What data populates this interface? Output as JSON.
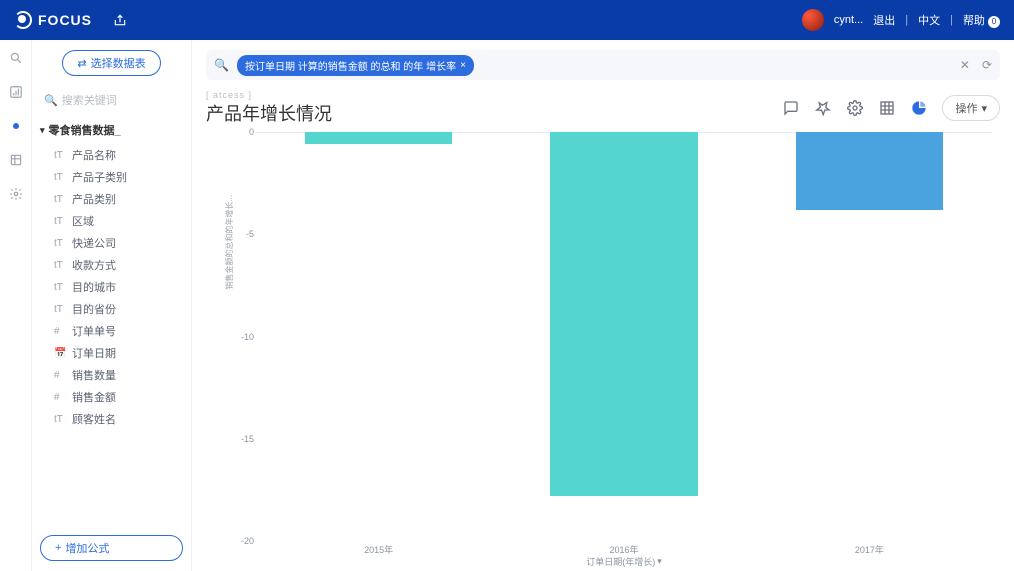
{
  "brand": "FOCUS",
  "header": {
    "user": "cynt...",
    "logout": "退出",
    "lang": "中文",
    "help": "帮助",
    "help_badge": "0"
  },
  "sidebar": {
    "select_btn": "选择数据表",
    "search_placeholder": "搜索关键词",
    "group": "零食销售数据_",
    "items": [
      {
        "icon": "tT",
        "label": "产品名称"
      },
      {
        "icon": "tT",
        "label": "产品子类别"
      },
      {
        "icon": "tT",
        "label": "产品类别"
      },
      {
        "icon": "tT",
        "label": "区域"
      },
      {
        "icon": "tT",
        "label": "快递公司"
      },
      {
        "icon": "tT",
        "label": "收款方式"
      },
      {
        "icon": "tT",
        "label": "目的城市"
      },
      {
        "icon": "tT",
        "label": "目的省份"
      },
      {
        "icon": "#",
        "label": "订单单号"
      },
      {
        "icon": "📅",
        "label": "订单日期"
      },
      {
        "icon": "#",
        "label": "销售数量"
      },
      {
        "icon": "#",
        "label": "销售金额"
      },
      {
        "icon": "tT",
        "label": "顾客姓名"
      }
    ],
    "add_formula": "增加公式"
  },
  "query": {
    "chip": "按订单日期 计算的销售金额 的总和 的年 增长率",
    "chip_close": "×"
  },
  "page": {
    "breadcrumb": "[ atcess ]",
    "title": "产品年增长情况",
    "op_btn": "操作"
  },
  "chart_data": {
    "type": "bar",
    "title": "产品年增长情况",
    "xlabel": "订单日期(年增长)",
    "ylabel": "销售金额的总和的年增长...",
    "categories": [
      "2015年",
      "2016年",
      "2017年"
    ],
    "values": [
      -0.6,
      -17.8,
      -3.8
    ],
    "ylim": [
      -20,
      0
    ],
    "y_ticks": [
      0,
      -5,
      -10,
      -15,
      -20
    ],
    "colors": [
      "#55D5D0",
      "#55D5D0",
      "#4AA3DF"
    ]
  }
}
